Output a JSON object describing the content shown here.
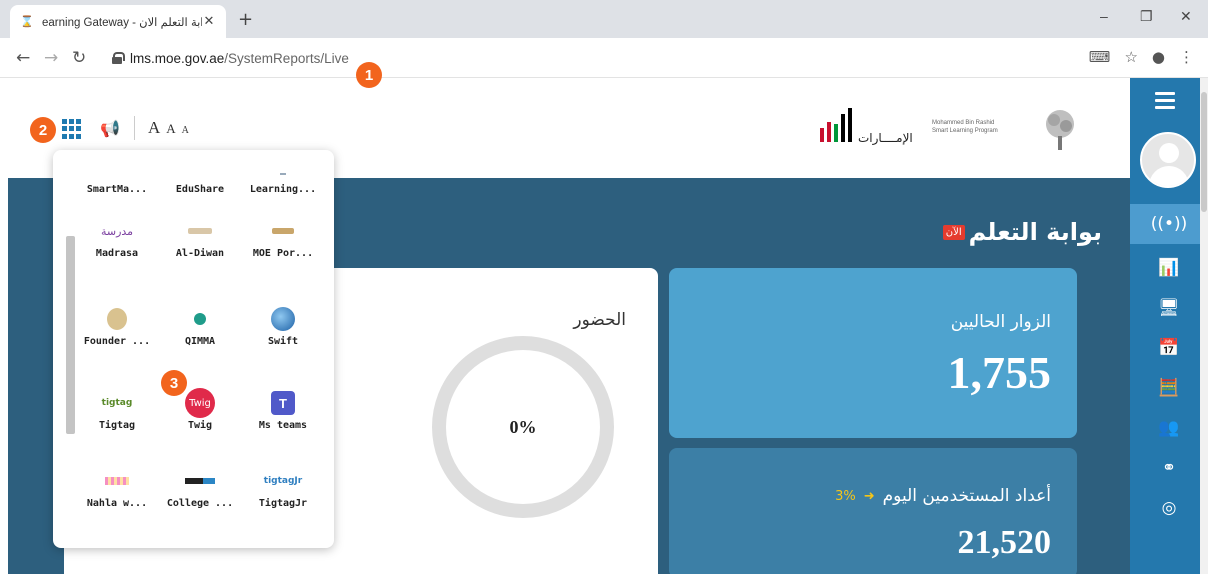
{
  "browser": {
    "tab_title": "earning Gateway - بوابة التعلم الان",
    "tab_close": "✕",
    "new_tab": "+",
    "url_host": "lms.moe.gov.ae",
    "url_path": "/SystemReports/Live",
    "window_controls": {
      "minimize": "–",
      "maximize": "❐",
      "close": "✕"
    }
  },
  "markers": [
    "1",
    "2",
    "3"
  ],
  "toolbar": {
    "font_large": "A",
    "font_medium": "A",
    "font_small": "A"
  },
  "header": {
    "uae_logo_text": "الإمــــارات",
    "mbr_logo_line1": "Mohammed Bin Rashid",
    "mbr_logo_line2": "Smart Learning Program"
  },
  "main": {
    "portal_title": "بوابة التعلم",
    "live_badge": "الآن",
    "visitors_label": "الزوار الحاليين",
    "visitors_value": "1,755",
    "users_label": "أعداد المستخدمين اليوم",
    "users_change": "3%",
    "users_value": "21,520",
    "attendance_label": "الحضور",
    "attendance_value": "0%"
  },
  "apps": [
    {
      "label": "SmartMa...",
      "icon": "smartma-icon"
    },
    {
      "label": "EduShare",
      "icon": "edushare-icon"
    },
    {
      "label": "Learning...",
      "icon": "learning-icon"
    },
    {
      "label": "Madrasa",
      "icon": "madrasa-icon"
    },
    {
      "label": "Al-Diwan",
      "icon": "aldiwan-icon"
    },
    {
      "label": "MOE Por...",
      "icon": "moe-portal-icon"
    },
    {
      "label": "Founder ...",
      "icon": "founder-icon"
    },
    {
      "label": "QIMMA",
      "icon": "qimma-icon"
    },
    {
      "label": "Swift",
      "icon": "swift-icon"
    },
    {
      "label": "Tigtag",
      "icon": "tigtag-icon"
    },
    {
      "label": "Twig",
      "icon": "twig-icon"
    },
    {
      "label": "Ms teams",
      "icon": "ms-teams-icon"
    },
    {
      "label": "Nahla w...",
      "icon": "nahla-icon"
    },
    {
      "label": "College ...",
      "icon": "college-icon"
    },
    {
      "label": "TigtagJr",
      "icon": "tigtagjr-icon"
    }
  ],
  "app_logo_text": {
    "madrasa": "مدرسة",
    "twig": "Twig",
    "tigtag": "tigtag",
    "tigtagjr": "tigtagJr"
  },
  "colors": {
    "accent": "#2478ad",
    "marker": "#f2641d",
    "main_bg": "#2d5f7e",
    "visitors_card": "#4ea3cf",
    "users_card": "#3c7fa6"
  }
}
